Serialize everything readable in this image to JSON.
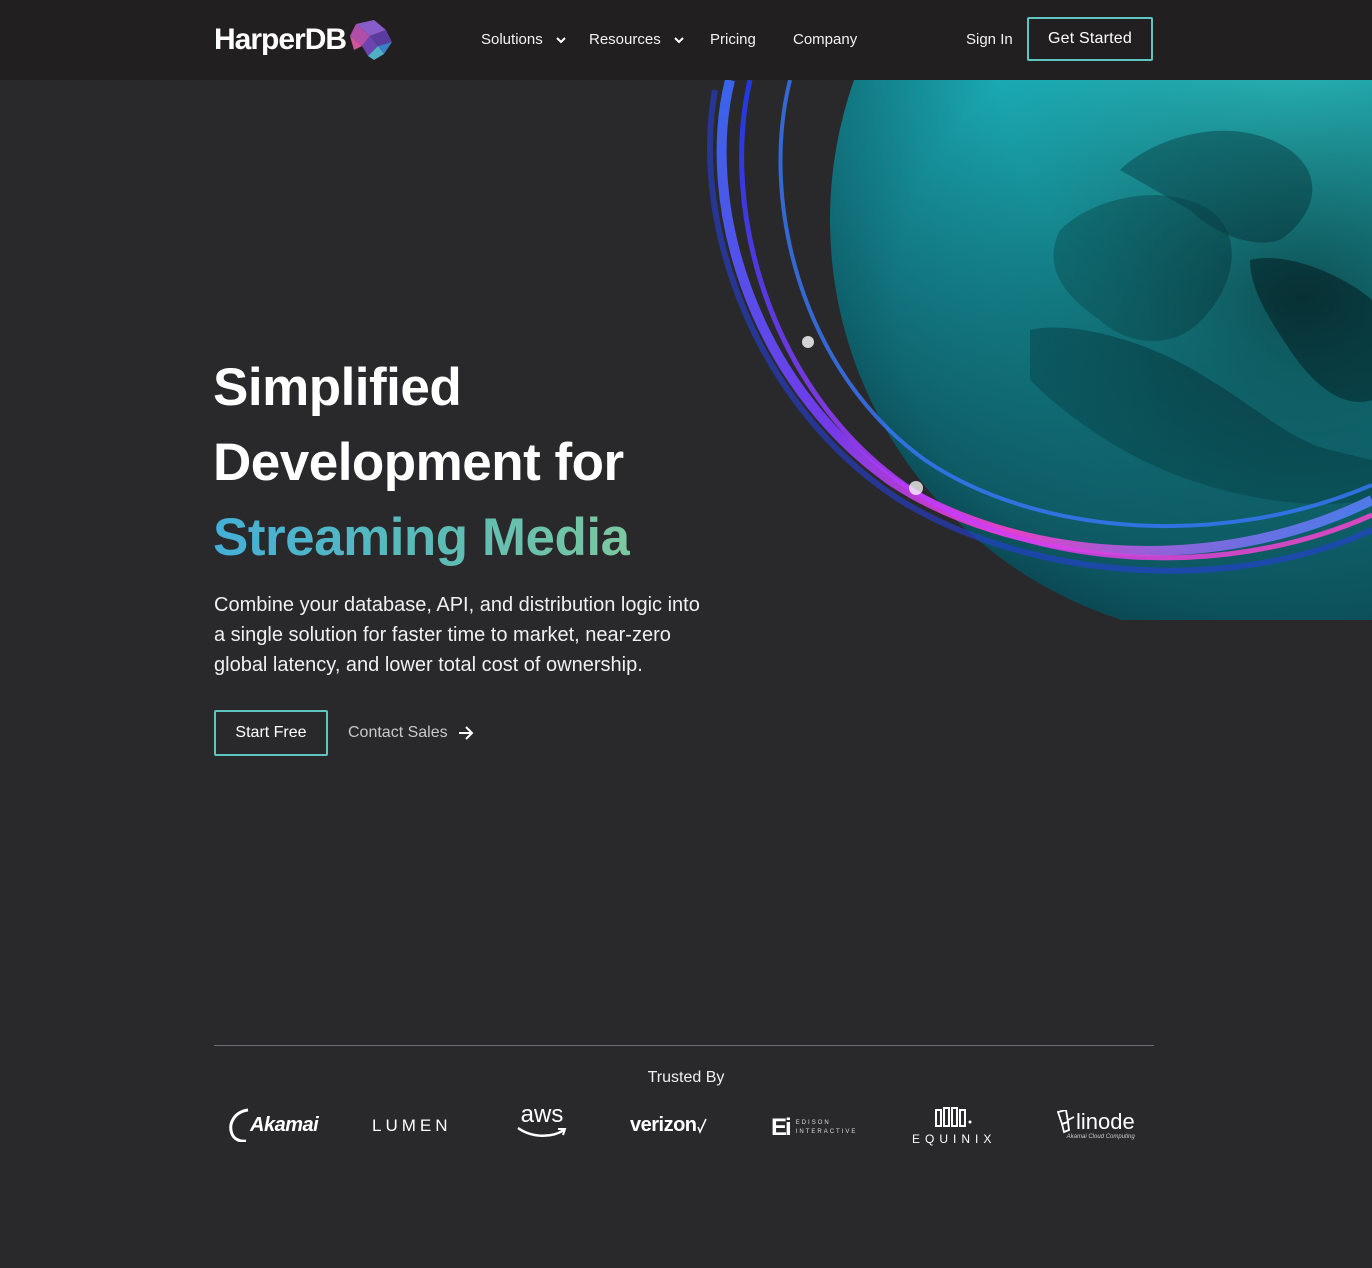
{
  "nav": {
    "logo_text": "HarperDB",
    "items": [
      {
        "label": "Solutions",
        "has_dropdown": true
      },
      {
        "label": "Resources",
        "has_dropdown": true
      },
      {
        "label": "Pricing",
        "has_dropdown": false
      },
      {
        "label": "Company",
        "has_dropdown": false
      }
    ],
    "sign_in": "Sign In",
    "get_started": "Get Started"
  },
  "hero": {
    "title_line1": "Simplified",
    "title_line2": "Development for",
    "title_line3": "Streaming Media",
    "description": "Combine your database, API, and distribution logic into a single solution for faster time to market, near-zero global latency, and lower total cost of ownership.",
    "start_free": "Start Free",
    "contact_sales": "Contact Sales"
  },
  "trusted": {
    "heading": "Trusted By",
    "logos": [
      {
        "name": "Akamai",
        "icon": "akamai-logo"
      },
      {
        "name": "LUMEN",
        "icon": "lumen-logo"
      },
      {
        "name": "aws",
        "icon": "aws-logo"
      },
      {
        "name": "verizon",
        "icon": "verizon-logo"
      },
      {
        "name": "EDISON INTERACTIVE",
        "big": "Ei",
        "line1": "EDISON",
        "line2": "INTERACTIVE",
        "icon": "edison-interactive-logo"
      },
      {
        "name": "EQUINIX",
        "icon": "equinix-logo"
      },
      {
        "name": "linode",
        "sub": "Akamai Cloud Computing",
        "icon": "linode-logo"
      }
    ]
  },
  "colors": {
    "background": "#29292c",
    "nav_background": "#221f20",
    "accent_border": "#5fc4c2",
    "gradient_start": "#44b0d8",
    "gradient_end": "#7cc8a0"
  }
}
